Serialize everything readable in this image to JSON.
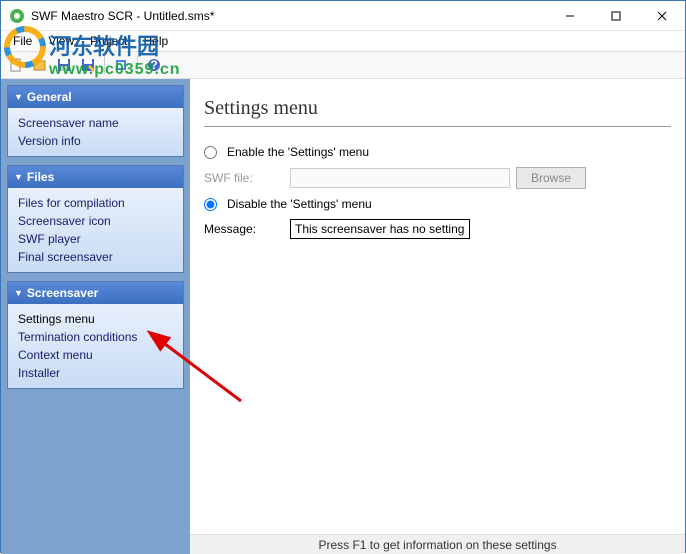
{
  "window": {
    "title": "SWF Maestro SCR - Untitled.sms*"
  },
  "menubar": {
    "file": "File",
    "view": "View",
    "project": "Project",
    "help": "Help"
  },
  "sidebar": {
    "general": {
      "title": "General",
      "items": [
        "Screensaver name",
        "Version info"
      ]
    },
    "files": {
      "title": "Files",
      "items": [
        "Files for compilation",
        "Screensaver icon",
        "SWF player",
        "Final screensaver"
      ]
    },
    "screensaver": {
      "title": "Screensaver",
      "items": [
        "Settings menu",
        "Termination conditions",
        "Context menu",
        "Installer"
      ]
    }
  },
  "content": {
    "heading": "Settings menu",
    "enable_label": "Enable the 'Settings' menu",
    "swf_label": "SWF file:",
    "swf_value": "",
    "browse": "Browse",
    "disable_label": "Disable the 'Settings' menu",
    "message_label": "Message:",
    "message_value": "This screensaver has no settings."
  },
  "statusbar": {
    "text": "Press F1 to get information on these settings"
  },
  "watermark": {
    "cn": "河东软件园",
    "url": "www.pc0359.cn"
  }
}
